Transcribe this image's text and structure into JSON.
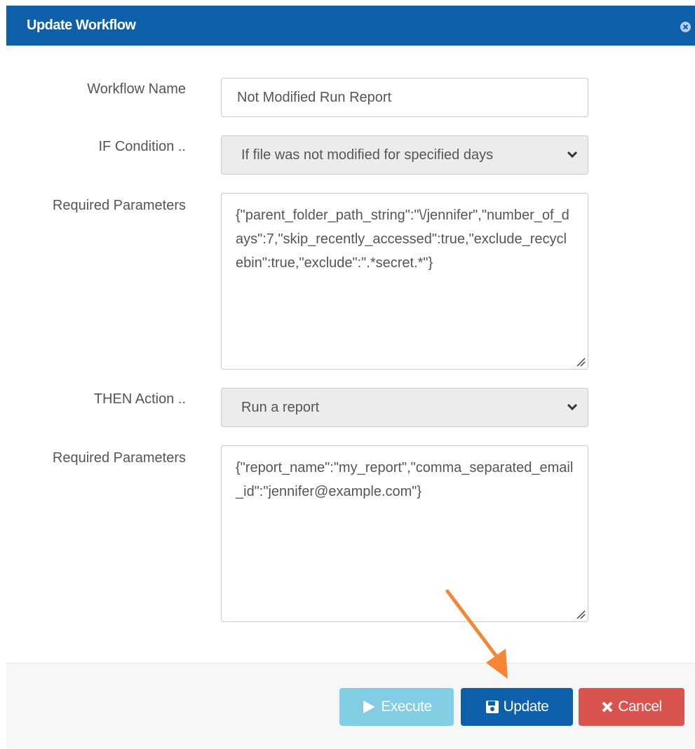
{
  "dialog": {
    "title": "Update Workflow",
    "close_icon": "close-circle-icon"
  },
  "form": {
    "workflow_name_label": "Workflow Name",
    "workflow_name_value": "Not Modified Run Report",
    "if_condition_label": "IF Condition ..",
    "if_condition_value": "If file was not modified for specified days",
    "required_params_label_1": "Required Parameters",
    "required_params_value_1": "{\"parent_folder_path_string\":\"\\/jennifer\",\"number_of_days\":7,\"skip_recently_accessed\":true,\"exclude_recyclebin\":true,\"exclude\":\".*secret.*\"}",
    "then_action_label": "THEN Action ..",
    "then_action_value": "Run a report",
    "required_params_label_2": "Required Parameters",
    "required_params_value_2": "{\"report_name\":\"my_report\",\"comma_separated_email_id\":\"jennifer@example.com\"}"
  },
  "footer": {
    "execute_label": "Execute",
    "update_label": "Update",
    "cancel_label": "Cancel"
  },
  "colors": {
    "header": "#0d60a9",
    "execute": "#5bc0de",
    "update": "#0d60a9",
    "cancel": "#d9534f",
    "annotation_arrow": "#f58634"
  }
}
